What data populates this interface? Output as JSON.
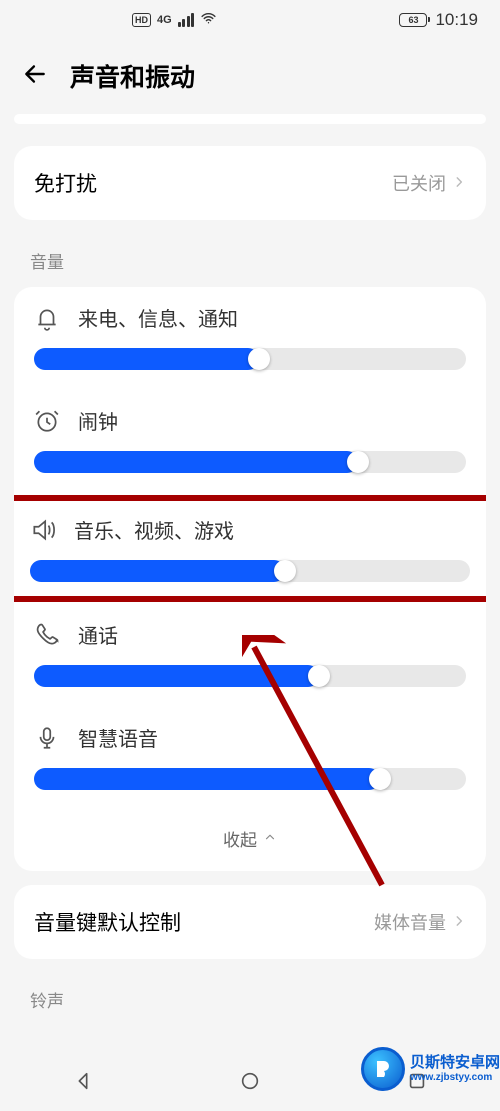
{
  "status": {
    "hd": "HD",
    "net": "4G",
    "battery": "63",
    "time": "10:19"
  },
  "header": {
    "title": "声音和振动"
  },
  "dnd": {
    "label": "免打扰",
    "value": "已关闭"
  },
  "section_volume": "音量",
  "sliders": {
    "ring": {
      "label": "来电、信息、通知",
      "percent": 52
    },
    "alarm": {
      "label": "闹钟",
      "percent": 75
    },
    "media": {
      "label": "音乐、视频、游戏",
      "percent": 58
    },
    "call": {
      "label": "通话",
      "percent": 66
    },
    "voice": {
      "label": "智慧语音",
      "percent": 80
    }
  },
  "collapse": "收起",
  "vol_key": {
    "label": "音量键默认控制",
    "value": "媒体音量"
  },
  "section_ringtone": "铃声",
  "watermark": {
    "line1": "贝斯特安卓网",
    "line2": "www.zjbstyy.com"
  }
}
